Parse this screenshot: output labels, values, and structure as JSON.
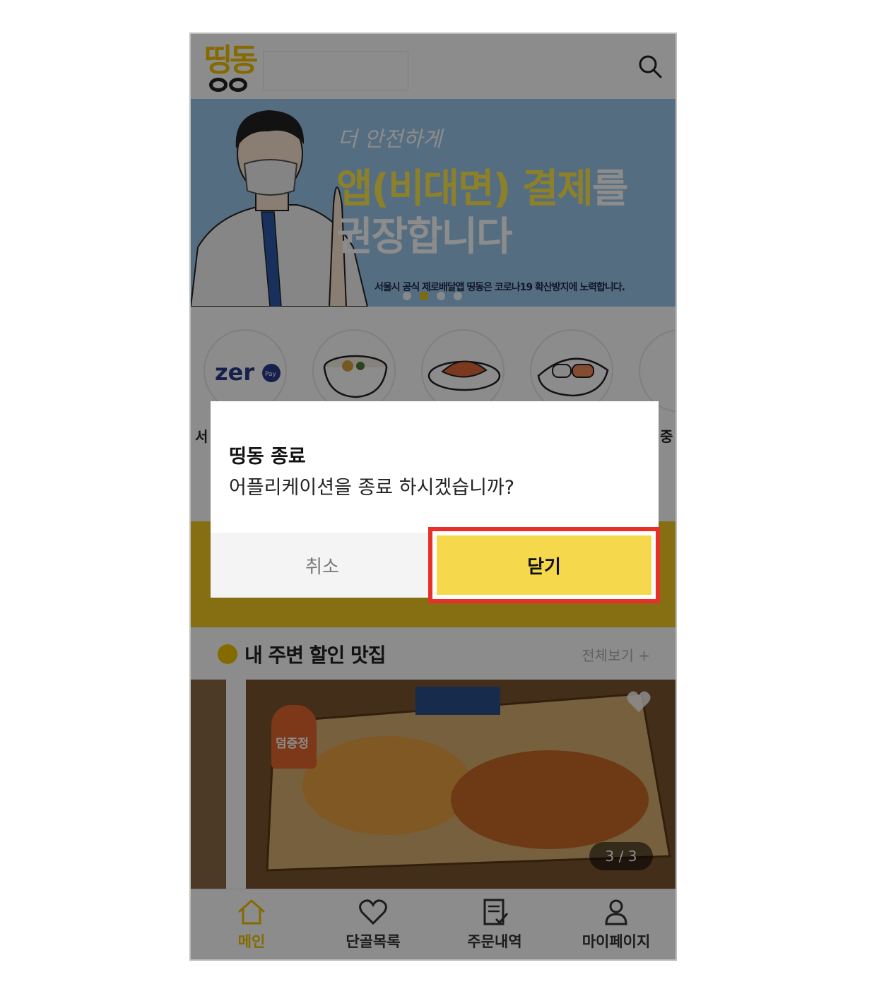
{
  "app": {
    "logo_text": "띵동",
    "search_icon": "search-icon"
  },
  "banner": {
    "line_small": "더 안전하게",
    "line_big_highlight": "앱(비대면) 결제",
    "line_big_suffix": "를",
    "line_big2": "권장합니다",
    "caption": "서울시 공식 제로배달앱 띵동은 코로나19 확산방지에 노력합니다.",
    "active_dot": 2,
    "dot_count": 4
  },
  "categories": {
    "first_label": "zero",
    "first_badge": "Pay",
    "left_label_fragment": "서",
    "right_label_fragment": "중"
  },
  "section": {
    "title": "내 주변 할인 맛집",
    "more": "전체보기 +"
  },
  "card": {
    "tag": "덤증정",
    "counter": "3 / 3"
  },
  "nav": {
    "items": [
      {
        "label": "메인",
        "icon": "home-icon",
        "active": true
      },
      {
        "label": "단골목록",
        "icon": "heart-icon",
        "active": false
      },
      {
        "label": "주문내역",
        "icon": "receipt-icon",
        "active": false
      },
      {
        "label": "마이페이지",
        "icon": "user-icon",
        "active": false
      }
    ]
  },
  "dialog": {
    "title": "띵동 종료",
    "message": "어플리케이션을 종료 하시겠습니까?",
    "cancel": "취소",
    "confirm": "닫기"
  },
  "colors": {
    "brand_yellow": "#f2c200",
    "confirm_button": "#f6d84c",
    "highlight_border": "#e8302a",
    "banner_bg": "#9cc6ec"
  }
}
